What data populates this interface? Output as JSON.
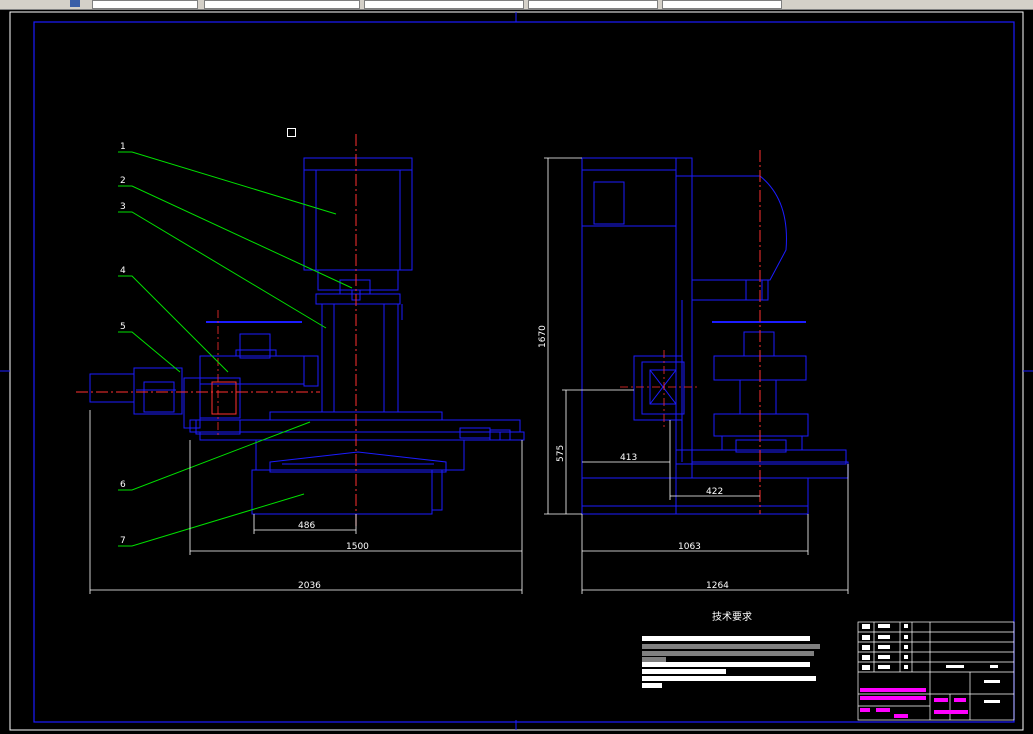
{
  "app": {
    "toolbar_slots": 6
  },
  "drawing": {
    "front_view": {
      "balloons": [
        "1",
        "2",
        "3",
        "4",
        "5",
        "6",
        "7"
      ],
      "dims": {
        "d486": "486",
        "d1500": "1500",
        "d2036": "2036"
      }
    },
    "side_view": {
      "dims": {
        "d1670": "1670",
        "d575": "575",
        "d413": "413",
        "d422": "422",
        "d1063": "1063",
        "d1264": "1264"
      }
    },
    "notes_title": "技术要求"
  },
  "colors": {
    "blue": "#1c1cff",
    "green": "#00e000",
    "red": "#ff3030",
    "white": "#ffffff",
    "magenta": "#ff00ff"
  }
}
